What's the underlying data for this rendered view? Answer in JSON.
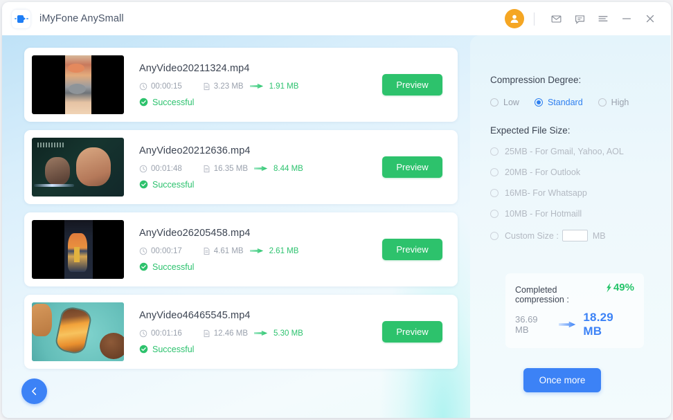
{
  "window": {
    "app_title": "iMyFone AnySmall",
    "logo_icon": "video-camera-icon",
    "titlebar_actions": [
      {
        "icon": "account-avatar-icon",
        "name": "account-avatar"
      },
      {
        "icon": "mail-icon",
        "name": "mail-button"
      },
      {
        "icon": "feedback-icon",
        "name": "feedback-button"
      },
      {
        "icon": "menu-icon",
        "name": "menu-button"
      },
      {
        "icon": "minimize-icon",
        "name": "minimize-button"
      },
      {
        "icon": "close-icon",
        "name": "close-button"
      }
    ]
  },
  "files": [
    {
      "name": "AnyVideo20211324.mp4",
      "duration": "00:00:15",
      "original_size": "3.23 MB",
      "new_size": "1.91 MB",
      "status": "Successful",
      "preview_label": "Preview",
      "thumb_class": "th1"
    },
    {
      "name": "AnyVideo20212636.mp4",
      "duration": "00:01:48",
      "original_size": "16.35 MB",
      "new_size": "8.44 MB",
      "status": "Successful",
      "preview_label": "Preview",
      "thumb_class": "th2"
    },
    {
      "name": "AnyVideo26205458.mp4",
      "duration": "00:00:17",
      "original_size": "4.61 MB",
      "new_size": "2.61 MB",
      "status": "Successful",
      "preview_label": "Preview",
      "thumb_class": "th3"
    },
    {
      "name": "AnyVideo46465545.mp4",
      "duration": "00:01:16",
      "original_size": "12.46 MB",
      "new_size": "5.30 MB",
      "status": "Successful",
      "preview_label": "Preview",
      "thumb_class": "th4"
    }
  ],
  "settings": {
    "compression_degree_label": "Compression Degree:",
    "degrees": [
      {
        "label": "Low",
        "selected": false
      },
      {
        "label": "Standard",
        "selected": true
      },
      {
        "label": "High",
        "selected": false
      }
    ],
    "expected_file_size_label": "Expected File Size:",
    "size_options": [
      {
        "label": "25MB - For Gmail, Yahoo, AOL",
        "selected": false
      },
      {
        "label": "20MB - For Outlook",
        "selected": false
      },
      {
        "label": "16MB- For Whatsapp",
        "selected": false
      },
      {
        "label": "10MB - For Hotmaill",
        "selected": false
      }
    ],
    "custom": {
      "label": "Custom Size :",
      "value": "",
      "placeholder": "",
      "unit": "MB",
      "selected": false
    }
  },
  "result": {
    "completed_label": "Completed compression :",
    "percent": "49%",
    "original_total": "36.69 MB",
    "new_total": "18.29 MB",
    "once_more_label": "Once more"
  },
  "nav": {
    "back_icon": "chevron-left-icon"
  },
  "colors": {
    "accent_blue": "#3c82f6",
    "success_green": "#2dc26c",
    "avatar_orange": "#f5a623",
    "muted_text": "#9aa1ad"
  }
}
